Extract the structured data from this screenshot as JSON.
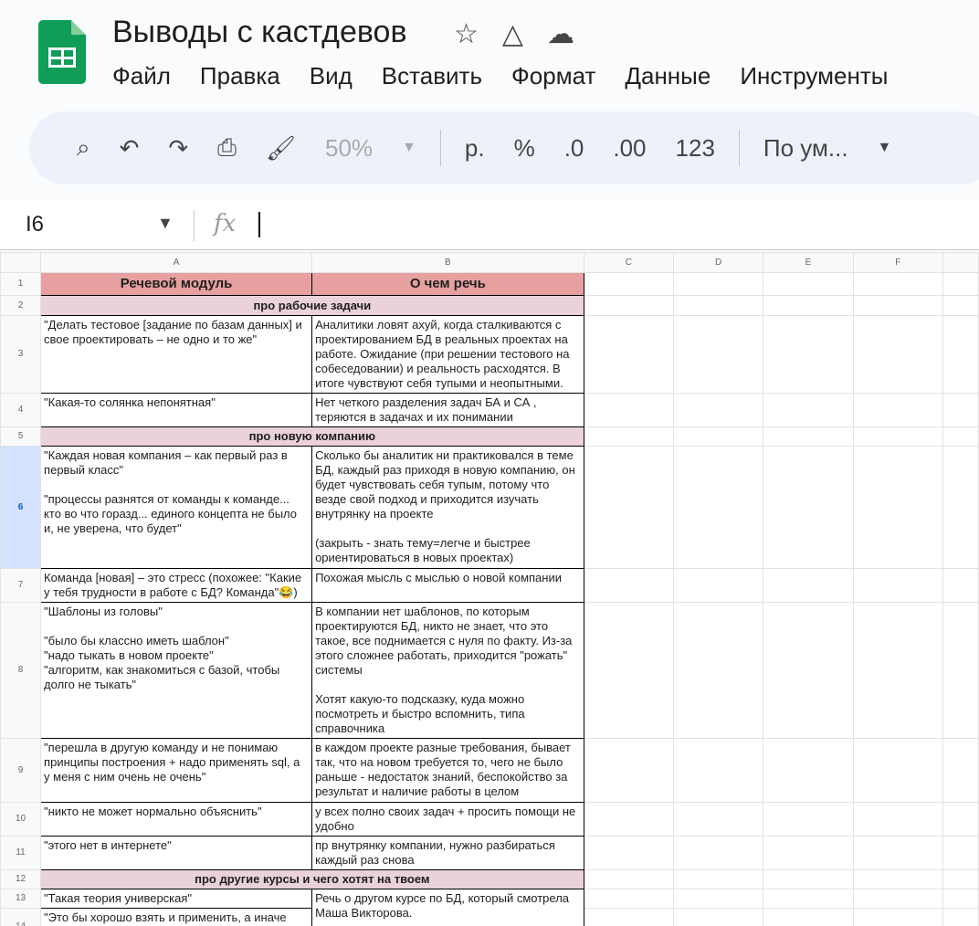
{
  "app": {
    "title": "Выводы с кастдевов",
    "menu": [
      "Файл",
      "Правка",
      "Вид",
      "Вставить",
      "Формат",
      "Данные",
      "Инструменты"
    ]
  },
  "toolbar": {
    "zoom": "50%",
    "currency": "р.",
    "percent": "%",
    "dec_decrease": ".0",
    "dec_increase": ".00",
    "number_format": "123",
    "font": "По ум..."
  },
  "formula_bar": {
    "cell": "I6",
    "fx": "fx",
    "value": ""
  },
  "columns": [
    "A",
    "B",
    "C",
    "D",
    "E",
    "F"
  ],
  "rows": [
    {
      "n": "1",
      "type": "header",
      "a": "Речевой модуль",
      "b": "О чем речь",
      "h": 25
    },
    {
      "n": "2",
      "type": "section",
      "text": "про рабочие задачи",
      "h": 22
    },
    {
      "n": "3",
      "a": "\"Делать тестовое [задание по базам данных] и свое проектировать – не одно и то же\"",
      "b": "Аналитики ловят ахуй, когда сталкиваются с проектированием БД в реальных проектах на работе. Ожидание (при решении тестового на собеседовании) и реальность расходятся. В итоге чувствуют себя тупыми и неопытными.",
      "h": 85
    },
    {
      "n": "4",
      "a": "\"Какая-то солянка непонятная\"",
      "b": "Нет четкого разделения задач БА и СА , теряются в задачах и их понимании",
      "h": 36
    },
    {
      "n": "5",
      "type": "section",
      "text": "про новую компанию",
      "h": 21
    },
    {
      "n": "6",
      "a": "\"Каждая новая компания – как первый раз в первый класс\"\n\n\"процессы разнятся от команды к команде... кто во что горазд... единого концепта не было и, не уверена, что будет\"",
      "b": "Сколько бы аналитик ни практиковался в теме БД, каждый раз приходя в новую компанию, он будет чувствовать себя тупым, потому что везде свой подход и приходится изучать внутрянку на проекте\n\n(закрыть - знать тему=легче и быстрее ориентироваться в новых проектах)",
      "h": 134,
      "selected": true
    },
    {
      "n": "7",
      "a": "Команда [новая] – это стресс (похожее: \"Какие у тебя трудности в работе с БД? Команда\"😂)",
      "b": "Похожая мысль с мыслью о новой компании",
      "h": 37
    },
    {
      "n": "8",
      "a": "\"Шаблоны из головы\"\n\n\"было бы классно иметь шаблон\"\n\"надо тыкать в новом проекте\"\n\"алгоритм, как знакомиться с базой, чтобы долго не тыкать\"",
      "b": "В компании нет шаблонов, по которым проектируются БД, никто не знает, что это такое, все поднимается с нуля по факту. Из-за этого сложнее работать, приходится \"рожать\" системы\n\nХотят какую-то подсказку, куда можно посмотреть и быстро вспомнить, типа справочника",
      "h": 148
    },
    {
      "n": "9",
      "a": "\"перешла в другую команду и не понимаю принципы построения + надо применять sql, а у меня с ним очень не очень\"",
      "b": "в каждом проекте разные требования, бывает так, что на новом требуется то, чего не было раньше - недостаток знаний, беспокойство за результат и наличие работы в целом",
      "h": 70
    },
    {
      "n": "10",
      "a": "\"никто не может нормально объяснить\"",
      "b": "у всех полно своих задач + просить помощи не удобно",
      "h": 36
    },
    {
      "n": "11",
      "a": "\"этого нет в интернете\"",
      "b": "пр внутрянку компании, нужно разбираться каждый раз снова",
      "h": 37
    },
    {
      "n": "12",
      "type": "section",
      "text": "про другие курсы и чего хотят на твоем",
      "h": 21
    },
    {
      "n": "13",
      "a": "\"Такая теория универская\"",
      "b": "Речь о другом курсе по БД, который смотрела Маша Викторова.",
      "h": 21
    },
    {
      "n": "14",
      "a": "\"Это бы хорошо взять и применить, а иначе",
      "h": 40
    }
  ]
}
